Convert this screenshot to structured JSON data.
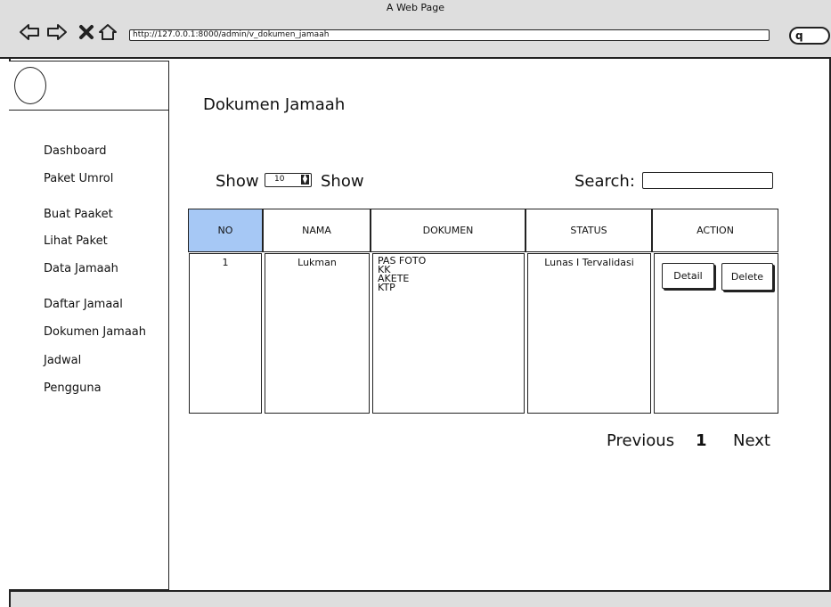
{
  "browser": {
    "title": "A Web Page",
    "url": "http://127.0.0.1:8000/admin/v_dokumen_jamaah"
  },
  "sidebar": {
    "items": [
      {
        "label": "Dashboard"
      },
      {
        "label": "Paket Umrol"
      },
      {
        "label": "Buat Paaket"
      },
      {
        "label": "Lihat Paket"
      },
      {
        "label": "Data Jamaah"
      },
      {
        "label": "Daftar Jamaal"
      },
      {
        "label": "Dokumen Jamaah"
      },
      {
        "label": "Jadwal"
      },
      {
        "label": "Pengguna"
      }
    ]
  },
  "main": {
    "title": "Dokumen Jamaah",
    "show_label": "Show",
    "show_value": "10",
    "show_label_after": "Show",
    "search_label": "Search:",
    "search_value": ""
  },
  "table": {
    "columns": [
      "NO",
      "NAMA",
      "DOKUMEN",
      "STATUS",
      "ACTION"
    ],
    "rows": [
      {
        "no": "1",
        "nama": "Lukman",
        "dokumen": [
          "PAS FOTO",
          "KK",
          "AKETE",
          "KTP"
        ],
        "status": "Lunas I Tervalidasi",
        "actions": [
          "Detail",
          "Delete"
        ]
      }
    ],
    "header_highlight_color": "#a6c8f5"
  },
  "pagination": {
    "previous": "Previous",
    "current": "1",
    "next": "Next"
  }
}
